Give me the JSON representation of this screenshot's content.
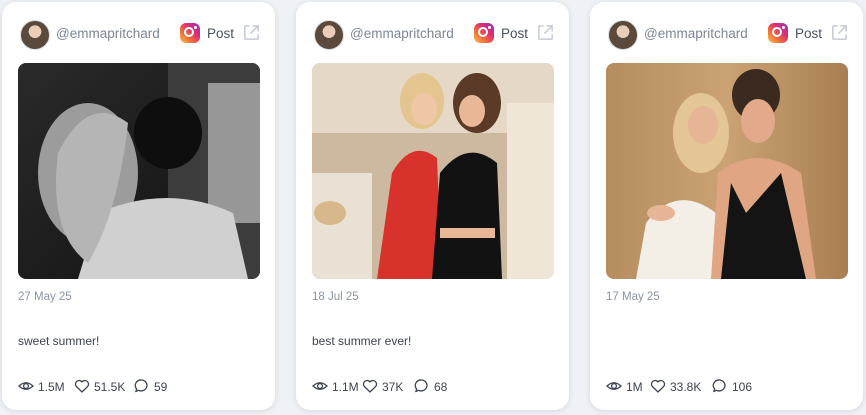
{
  "posts": [
    {
      "handle": "@emmapritchard",
      "platform_label": "Post",
      "date": "27 May 25",
      "caption": "sweet summer!",
      "views": "1.5M",
      "likes": "51.5K",
      "comments": "59"
    },
    {
      "handle": "@emmapritchard",
      "platform_label": "Post",
      "date": "18 Jul 25",
      "caption": "best summer ever!",
      "views": "1.1M",
      "likes": "37K",
      "comments": "68"
    },
    {
      "handle": "@emmapritchard",
      "platform_label": "Post",
      "date": "17 May 25",
      "caption": "",
      "views": "1M",
      "likes": "33.8K",
      "comments": "106"
    }
  ],
  "icons": {
    "platform": "instagram-icon",
    "external": "external-link-icon",
    "views": "eye-icon",
    "likes": "heart-icon",
    "comments": "comment-icon"
  },
  "colors": {
    "background": "#eef1f5",
    "card": "#ffffff",
    "muted_text": "#8b93a3",
    "body_text": "#3d4452"
  }
}
